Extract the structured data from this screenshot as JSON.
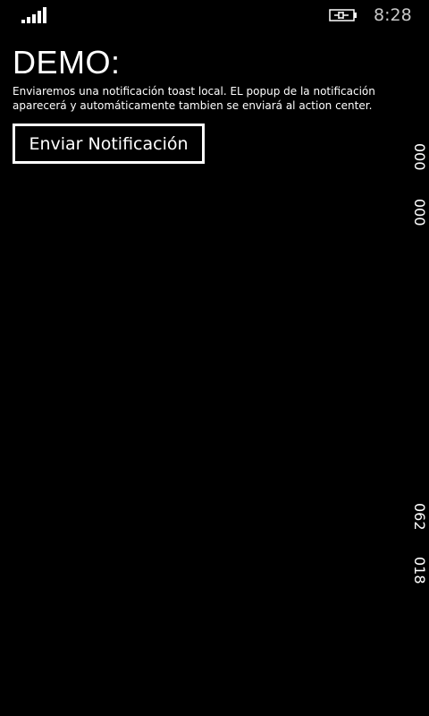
{
  "status_bar": {
    "time": "8:28",
    "signal_icon": "signal-strength-icon",
    "battery_icon": "battery-charging-icon"
  },
  "page": {
    "title": "DEMO:",
    "description": "Enviaremos una notificación toast local. EL popup de la notificación aparecerá y automáticamente tambien se enviará al action center."
  },
  "actions": {
    "send_label": "Enviar Notificación"
  },
  "frame_counters": {
    "top_1": "000",
    "top_2": "000",
    "bottom_1": "062",
    "bottom_2": "018"
  },
  "colors": {
    "background": "#000000",
    "foreground": "#ffffff",
    "clock": "#c8c8c8"
  }
}
